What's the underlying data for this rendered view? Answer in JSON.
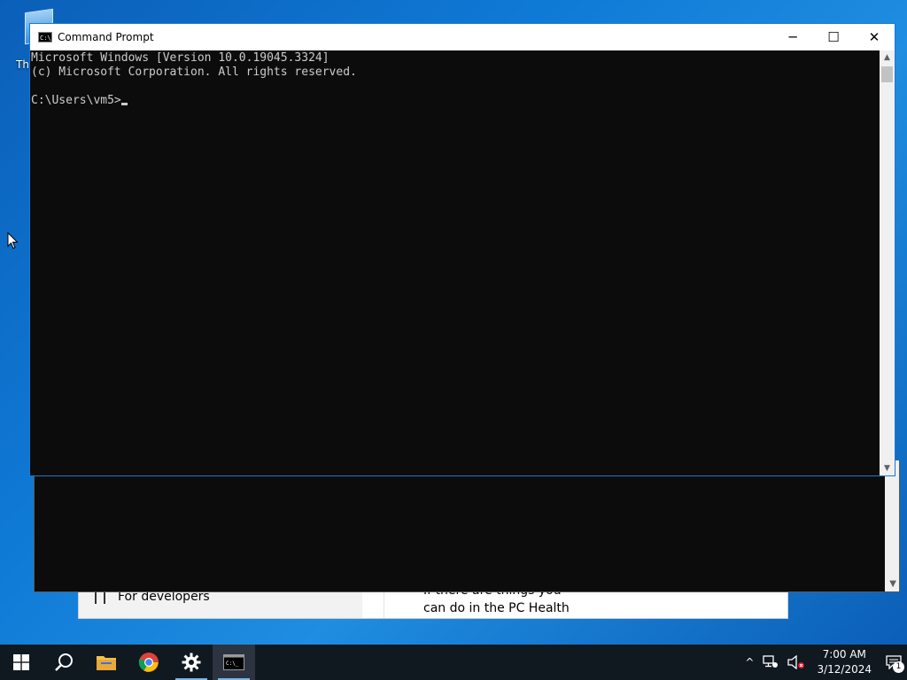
{
  "desktop": {
    "icon_label": "Th"
  },
  "settings_window": {
    "sidebar_item": "For developers",
    "content_text_line1": "If there are things you",
    "content_text_line2": "can do in the PC Health"
  },
  "cmd_window": {
    "title": "Command Prompt",
    "icon_text": "C:\\_",
    "minimize": "─",
    "maximize": "☐",
    "close": "✕",
    "console_lines": [
      "Microsoft Windows [Version 10.0.19045.3324]",
      "(c) Microsoft Corporation. All rights reserved.",
      "",
      "C:\\Users\\vm5>"
    ]
  },
  "scrollbar": {
    "up_arrow": "▲",
    "down_arrow": "▼"
  },
  "taskbar": {
    "apps": [
      {
        "name": "start-button",
        "icon": "windows-logo"
      },
      {
        "name": "search-button",
        "icon": "search-icon"
      },
      {
        "name": "file-explorer",
        "icon": "folder-icon"
      },
      {
        "name": "chrome",
        "icon": "chrome-icon"
      },
      {
        "name": "settings",
        "icon": "gear-icon"
      },
      {
        "name": "command-prompt",
        "icon": "terminal-icon"
      }
    ],
    "tray": {
      "chevron": "^",
      "time": "7:00 AM",
      "date": "3/12/2024",
      "notification_count": "1"
    }
  },
  "colors": {
    "desktop_bg": "#0f7ad6",
    "console_bg": "#0c0c0c",
    "console_fg": "#cccccc",
    "taskbar_bg": "#101820",
    "window_border": "#1b78d2"
  }
}
